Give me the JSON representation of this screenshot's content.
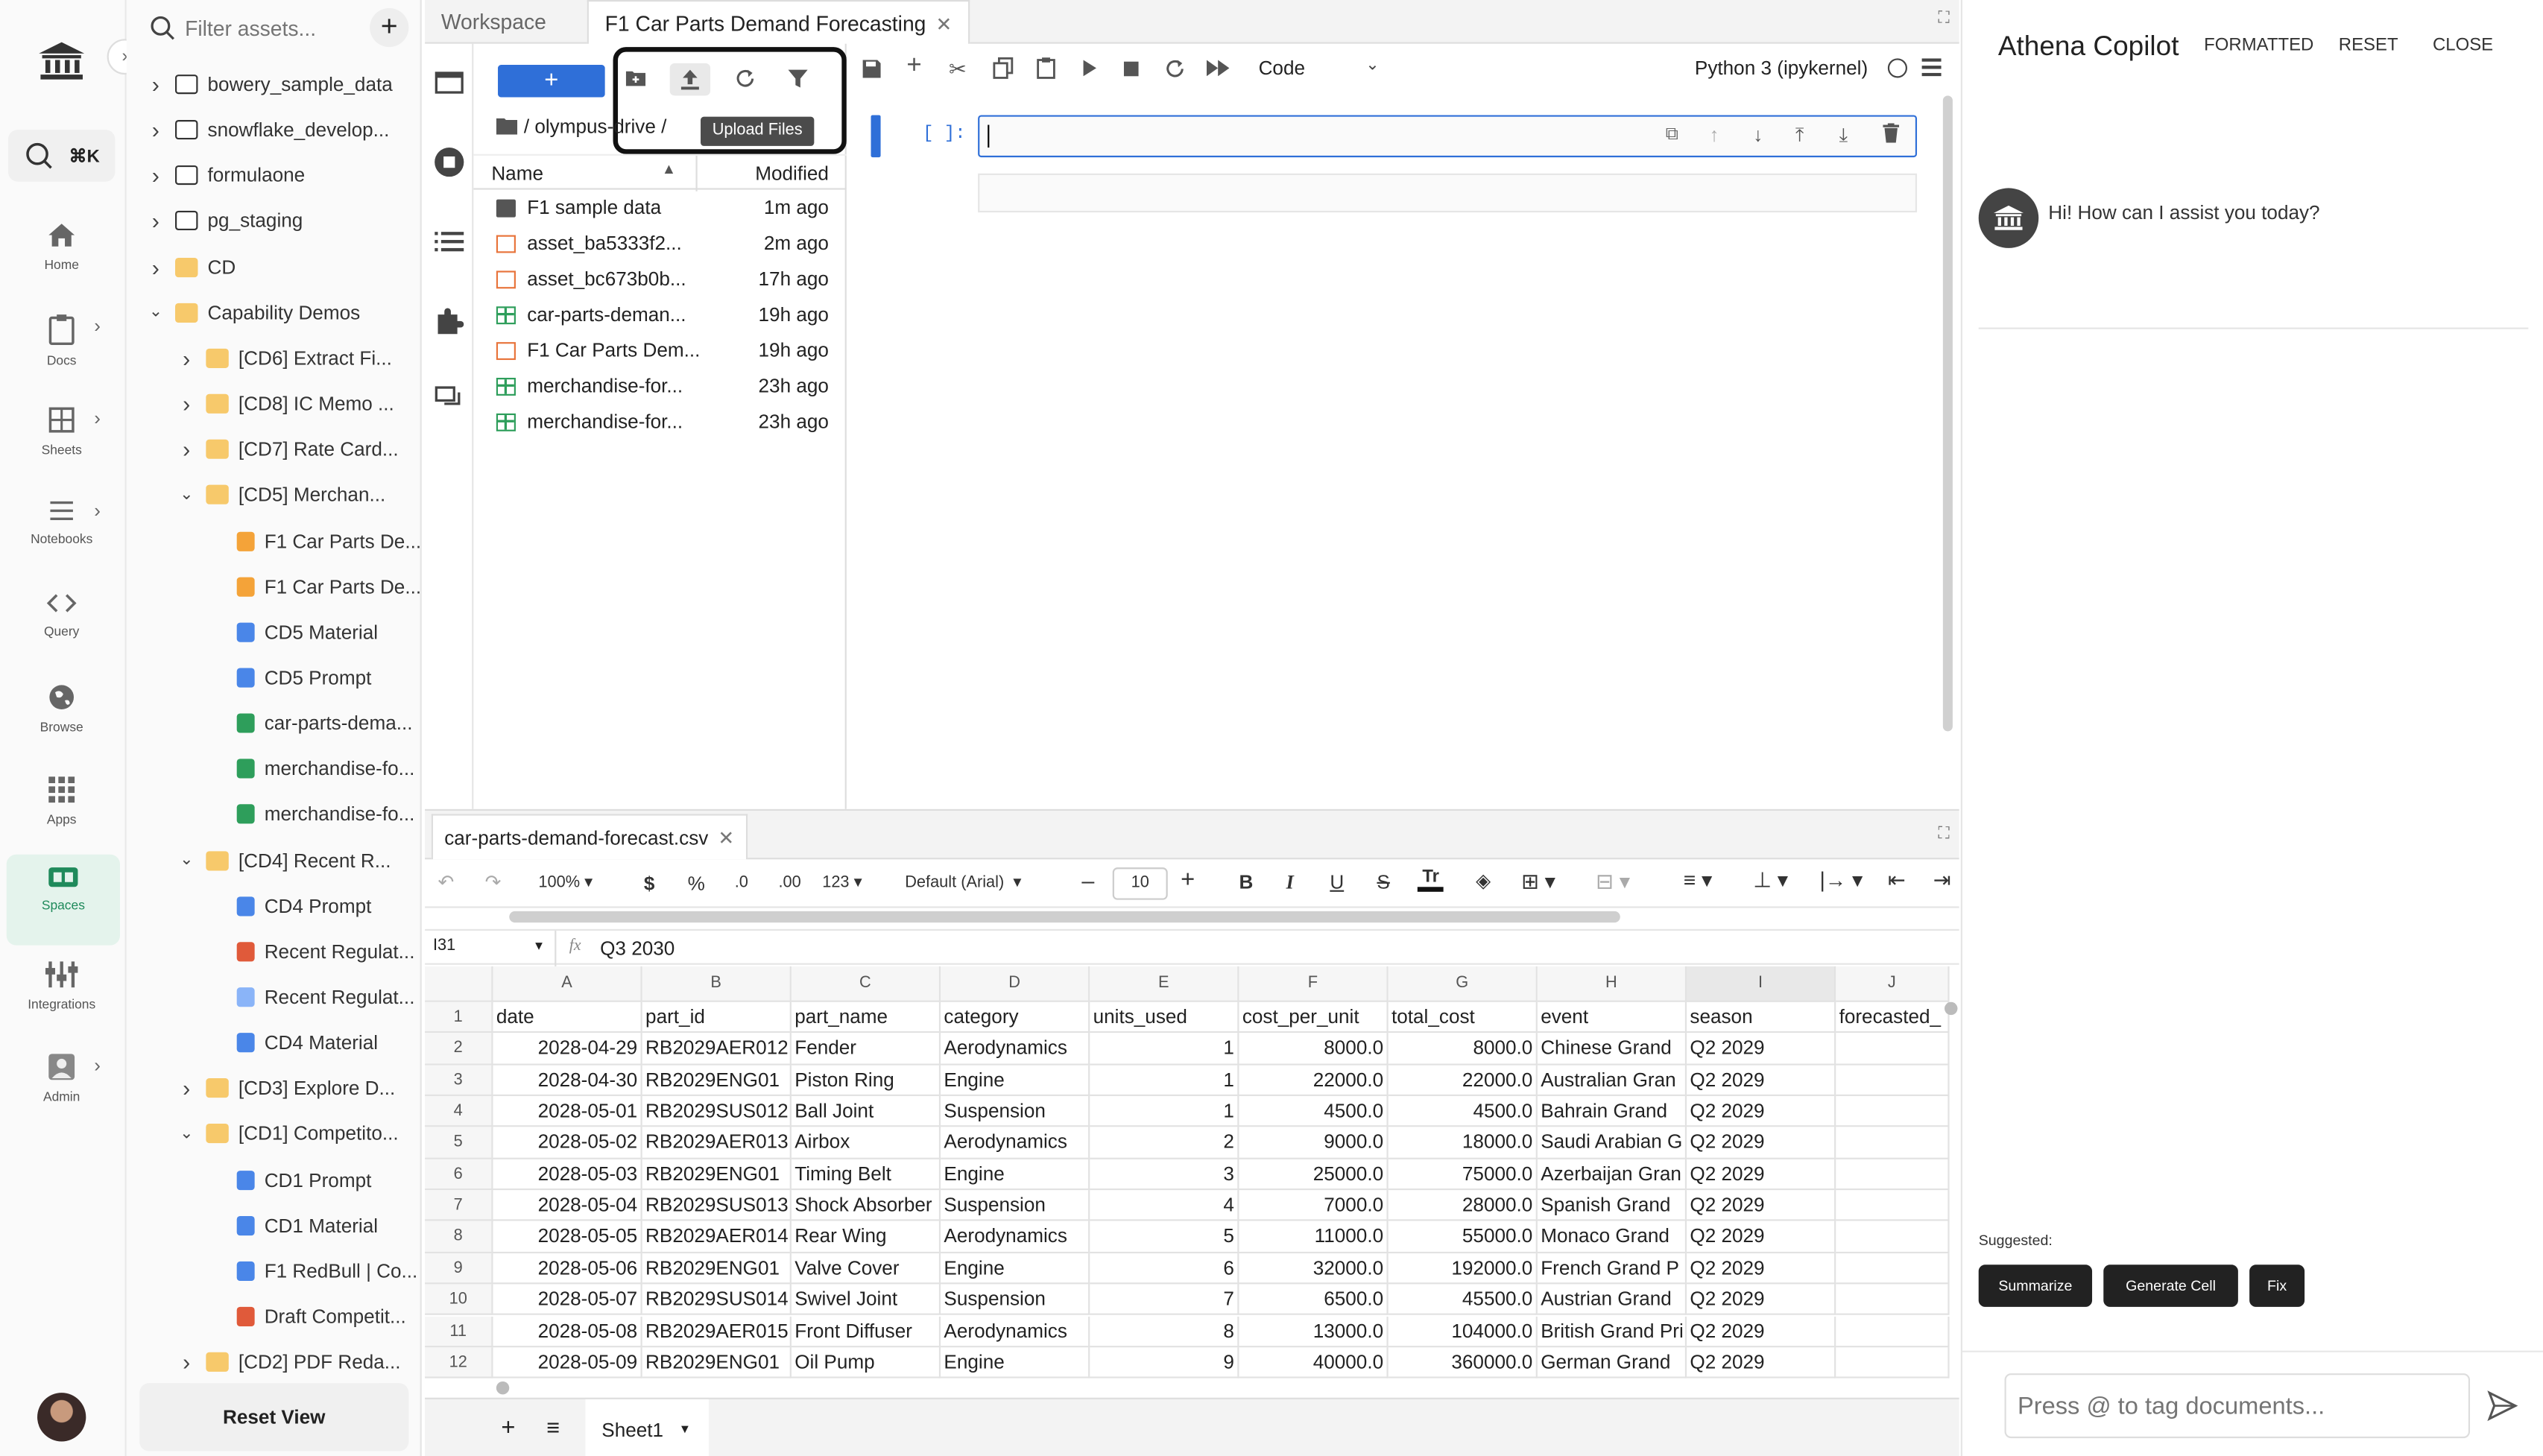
{
  "nav": {
    "search_shortcut": "⌘K",
    "items": [
      {
        "label": "Home"
      },
      {
        "label": "Docs"
      },
      {
        "label": "Sheets"
      },
      {
        "label": "Notebooks"
      },
      {
        "label": "Query"
      },
      {
        "label": "Browse"
      },
      {
        "label": "Apps"
      },
      {
        "label": "Spaces"
      },
      {
        "label": "Integrations"
      },
      {
        "label": "Admin"
      }
    ]
  },
  "tree": {
    "search_placeholder": "Filter assets...",
    "items": [
      {
        "label": "bowery_sample_data"
      },
      {
        "label": "snowflake_develop..."
      },
      {
        "label": "formulaone"
      },
      {
        "label": "pg_staging"
      },
      {
        "label": "CD"
      },
      {
        "label": "Capability Demos"
      },
      {
        "label": "[CD6] Extract Fi..."
      },
      {
        "label": "[CD8] IC Memo ..."
      },
      {
        "label": "[CD7] Rate Card..."
      },
      {
        "label": "[CD5] Merchan..."
      },
      {
        "label": "F1 Car Parts De..."
      },
      {
        "label": "F1 Car Parts De..."
      },
      {
        "label": "CD5 Material"
      },
      {
        "label": "CD5 Prompt"
      },
      {
        "label": "car-parts-dema..."
      },
      {
        "label": "merchandise-fo..."
      },
      {
        "label": "merchandise-fo..."
      },
      {
        "label": "[CD4] Recent R..."
      },
      {
        "label": "CD4 Prompt"
      },
      {
        "label": "Recent Regulat..."
      },
      {
        "label": "Recent Regulat..."
      },
      {
        "label": "CD4 Material"
      },
      {
        "label": "[CD3] Explore D..."
      },
      {
        "label": "[CD1] Competito..."
      },
      {
        "label": "CD1 Prompt"
      },
      {
        "label": "CD1 Material"
      },
      {
        "label": "F1 RedBull | Co..."
      },
      {
        "label": "Draft Competit..."
      },
      {
        "label": "[CD2] PDF Reda..."
      }
    ],
    "reset_label": "Reset View"
  },
  "tabs": [
    {
      "label": "Workspace"
    },
    {
      "label": "F1 Car Parts Demand Forecasting"
    }
  ],
  "filebrowser": {
    "path": "/ olympus-drive /",
    "tooltip": "Upload Files",
    "col_name": "Name",
    "col_modified": "Modified",
    "files": [
      {
        "name": "F1 sample data",
        "modified": "1m ago"
      },
      {
        "name": "asset_ba5333f2...",
        "modified": "2m ago"
      },
      {
        "name": "asset_bc673b0b...",
        "modified": "17h ago"
      },
      {
        "name": "car-parts-deman...",
        "modified": "19h ago"
      },
      {
        "name": "F1 Car Parts Dem...",
        "modified": "19h ago"
      },
      {
        "name": "merchandise-for...",
        "modified": "23h ago"
      },
      {
        "name": "merchandise-for...",
        "modified": "23h ago"
      }
    ]
  },
  "notebook": {
    "cell_type": "Code",
    "kernel": "Python 3 (ipykernel)",
    "prompt": "[ ]:"
  },
  "sheet": {
    "tab": "car-parts-demand-forecast.csv",
    "zoom": "100%",
    "currency": "$",
    "percent": "%",
    "dec_less": ".0",
    ".dec_more": ".00",
    "dec_more": ".00",
    "num_fmt": "123",
    "font": "Default (Arial)",
    "font_size": "10",
    "cell_ref": "I31",
    "formula": "Q3 2030",
    "sheet_name": "Sheet1",
    "columns": [
      "A",
      "B",
      "C",
      "D",
      "E",
      "F",
      "G",
      "H",
      "I",
      "J"
    ],
    "rows": [
      [
        "date",
        "part_id",
        "part_name",
        "category",
        "units_used",
        "cost_per_unit",
        "total_cost",
        "event",
        "season",
        "forecasted_"
      ],
      [
        "2028-04-29",
        "RB2029AER012",
        "Fender",
        "Aerodynamics",
        "1",
        "8000.0",
        "8000.0",
        "Chinese Grand",
        "Q2 2029",
        ""
      ],
      [
        "2028-04-30",
        "RB2029ENG01",
        "Piston Ring",
        "Engine",
        "1",
        "22000.0",
        "22000.0",
        "Australian Gran",
        "Q2 2029",
        ""
      ],
      [
        "2028-05-01",
        "RB2029SUS012",
        "Ball Joint",
        "Suspension",
        "1",
        "4500.0",
        "4500.0",
        "Bahrain Grand",
        "Q2 2029",
        ""
      ],
      [
        "2028-05-02",
        "RB2029AER013",
        "Airbox",
        "Aerodynamics",
        "2",
        "9000.0",
        "18000.0",
        "Saudi Arabian G",
        "Q2 2029",
        ""
      ],
      [
        "2028-05-03",
        "RB2029ENG01",
        "Timing Belt",
        "Engine",
        "3",
        "25000.0",
        "75000.0",
        "Azerbaijan Gran",
        "Q2 2029",
        ""
      ],
      [
        "2028-05-04",
        "RB2029SUS013",
        "Shock Absorber",
        "Suspension",
        "4",
        "7000.0",
        "28000.0",
        "Spanish Grand",
        "Q2 2029",
        ""
      ],
      [
        "2028-05-05",
        "RB2029AER014",
        "Rear Wing",
        "Aerodynamics",
        "5",
        "11000.0",
        "55000.0",
        "Monaco Grand",
        "Q2 2029",
        ""
      ],
      [
        "2028-05-06",
        "RB2029ENG01",
        "Valve Cover",
        "Engine",
        "6",
        "32000.0",
        "192000.0",
        "French Grand P",
        "Q2 2029",
        ""
      ],
      [
        "2028-05-07",
        "RB2029SUS014",
        "Swivel Joint",
        "Suspension",
        "7",
        "6500.0",
        "45500.0",
        "Austrian Grand",
        "Q2 2029",
        ""
      ],
      [
        "2028-05-08",
        "RB2029AER015",
        "Front Diffuser",
        "Aerodynamics",
        "8",
        "13000.0",
        "104000.0",
        "British Grand Pri",
        "Q2 2029",
        ""
      ],
      [
        "2028-05-09",
        "RB2029ENG01",
        "Oil Pump",
        "Engine",
        "9",
        "40000.0",
        "360000.0",
        "German Grand",
        "Q2 2029",
        ""
      ]
    ]
  },
  "copilot": {
    "title": "Athena Copilot",
    "formatted": "FORMATTED",
    "reset": "RESET",
    "close": "CLOSE",
    "greeting": "Hi! How can I assist you today?",
    "suggested": "Suggested:",
    "chips": [
      "Summarize",
      "Generate Cell",
      "Fix"
    ],
    "input_placeholder": "Press @ to tag documents..."
  }
}
